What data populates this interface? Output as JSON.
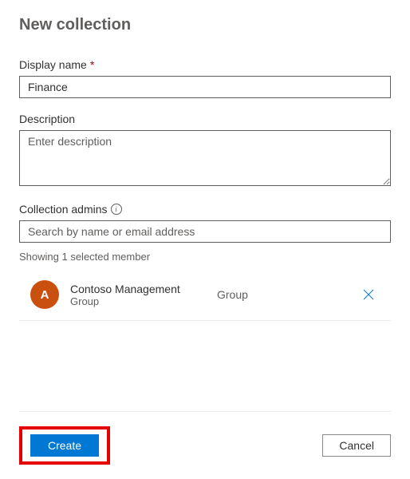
{
  "header": {
    "title": "New collection"
  },
  "fields": {
    "display_name": {
      "label": "Display name",
      "required_marker": "*",
      "value": "Finance"
    },
    "description": {
      "label": "Description",
      "placeholder": "Enter description",
      "value": ""
    },
    "collection_admins": {
      "label": "Collection admins",
      "placeholder": "Search by name or email address",
      "value": ""
    }
  },
  "members": {
    "hint": "Showing 1 selected member",
    "items": [
      {
        "avatar_initial": "A",
        "name": "Contoso Management",
        "subtype": "Group",
        "type": "Group"
      }
    ]
  },
  "actions": {
    "create": "Create",
    "cancel": "Cancel"
  }
}
